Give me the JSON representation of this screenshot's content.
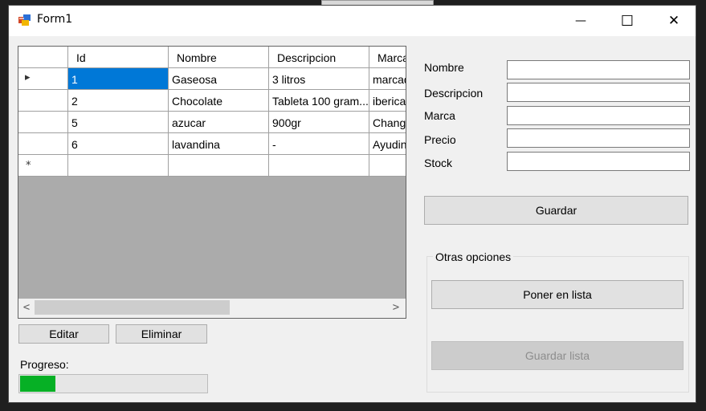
{
  "window": {
    "title": "Form1"
  },
  "titlebar": {
    "minimize_glyph": "—",
    "maximize_glyph": "☐",
    "close_glyph": "✕"
  },
  "grid": {
    "columns": [
      "Id",
      "Nombre",
      "Descripcion",
      "Marca"
    ],
    "rows": [
      [
        "1",
        "Gaseosa",
        "3 litros",
        "marcad"
      ],
      [
        "2",
        "Chocolate",
        "Tableta 100 gram...",
        "iberica"
      ],
      [
        "5",
        "azucar",
        "900gr",
        "Chang"
      ],
      [
        "6",
        "lavandina",
        "-",
        "Ayudin"
      ]
    ],
    "current_row_glyph": "▸",
    "new_row_glyph": "*",
    "scroll_left": "<",
    "scroll_right": ">"
  },
  "buttons": {
    "editar": "Editar",
    "eliminar": "Eliminar",
    "guardar": "Guardar",
    "poner_en_lista": "Poner en lista",
    "guardar_lista": "Guardar lista"
  },
  "form": {
    "fields": [
      {
        "label": "Nombre",
        "value": ""
      },
      {
        "label": "Descripcion",
        "value": ""
      },
      {
        "label": "Marca",
        "value": ""
      },
      {
        "label": "Precio",
        "value": ""
      },
      {
        "label": "Stock",
        "value": ""
      }
    ]
  },
  "progress": {
    "label": "Progreso:",
    "value_fraction": 0.19
  },
  "group": {
    "title": "Otras opciones"
  }
}
